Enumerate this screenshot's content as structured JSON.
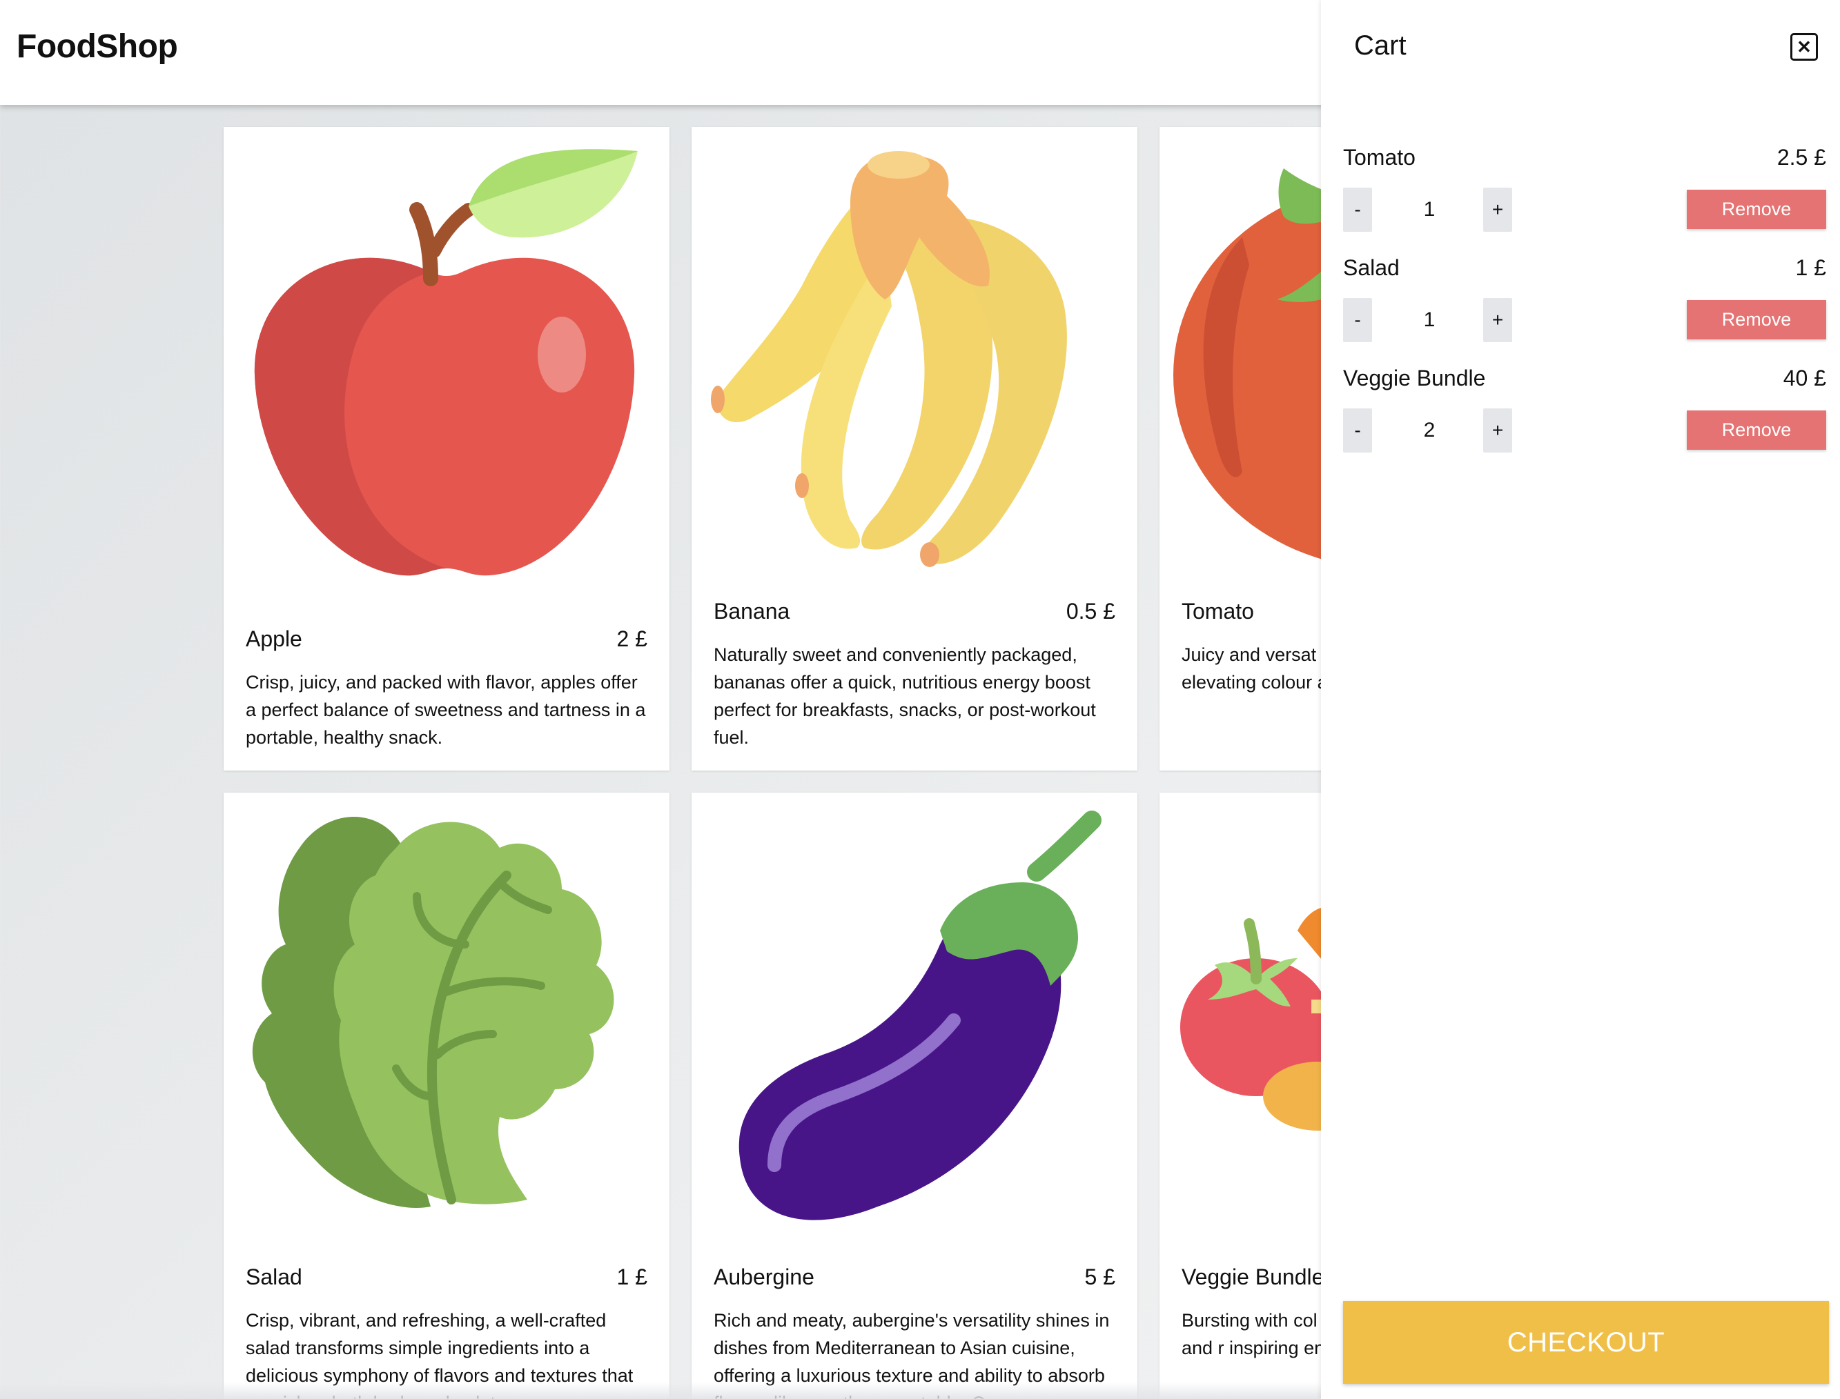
{
  "app": {
    "logo": "FoodShop"
  },
  "products": [
    {
      "name": "Apple",
      "price": "2 £",
      "description": "Crisp, juicy, and packed with flavor, apples offer a perfect balance of sweetness and tartness in a portable, healthy snack.",
      "icon": "apple-icon"
    },
    {
      "name": "Banana",
      "price": "0.5 £",
      "description": "Naturally sweet and conveniently packaged, bananas offer a quick, nutritious energy boost perfect for breakfasts, snacks, or post-workout fuel.",
      "icon": "banana-icon"
    },
    {
      "name": "Tomato",
      "price": "",
      "description": "Juicy and versat sweet-tart flavor sauces, elevating colour and rich t",
      "icon": "tomato-icon"
    },
    {
      "name": "Salad",
      "price": "1 £",
      "description": "Crisp, vibrant, and refreshing, a well-crafted salad transforms simple ingredients into a delicious symphony of flavors and textures that nourishes both body and palate.",
      "icon": "lettuce-icon"
    },
    {
      "name": "Aubergine",
      "price": "5 £",
      "description": "Rich and meaty, aubergine's versatility shines in dishes from Mediterranean to Asian cuisine, offering a luxurious texture and ability to absorb flavors like no other vegetable. Copy",
      "icon": "aubergine-icon"
    },
    {
      "name": "Veggie Bundle",
      "price": "",
      "description": "Bursting with col vegetable bundle add variety and r inspiring endless",
      "icon": "veggie-bundle-icon"
    }
  ],
  "cart": {
    "title": "Cart",
    "close_icon": "close-icon",
    "items": [
      {
        "name": "Tomato",
        "price": "2.5 £",
        "quantity": "1",
        "minus": "-",
        "plus": "+",
        "remove": "Remove"
      },
      {
        "name": "Salad",
        "price": "1 £",
        "quantity": "1",
        "minus": "-",
        "plus": "+",
        "remove": "Remove"
      },
      {
        "name": "Veggie Bundle",
        "price": "40 £",
        "quantity": "2",
        "minus": "-",
        "plus": "+",
        "remove": "Remove"
      }
    ],
    "checkout_label": "CHECKOUT"
  },
  "colors": {
    "remove": "#e57373",
    "checkout": "#f0bf48",
    "qty_button": "#e4e6e9"
  }
}
